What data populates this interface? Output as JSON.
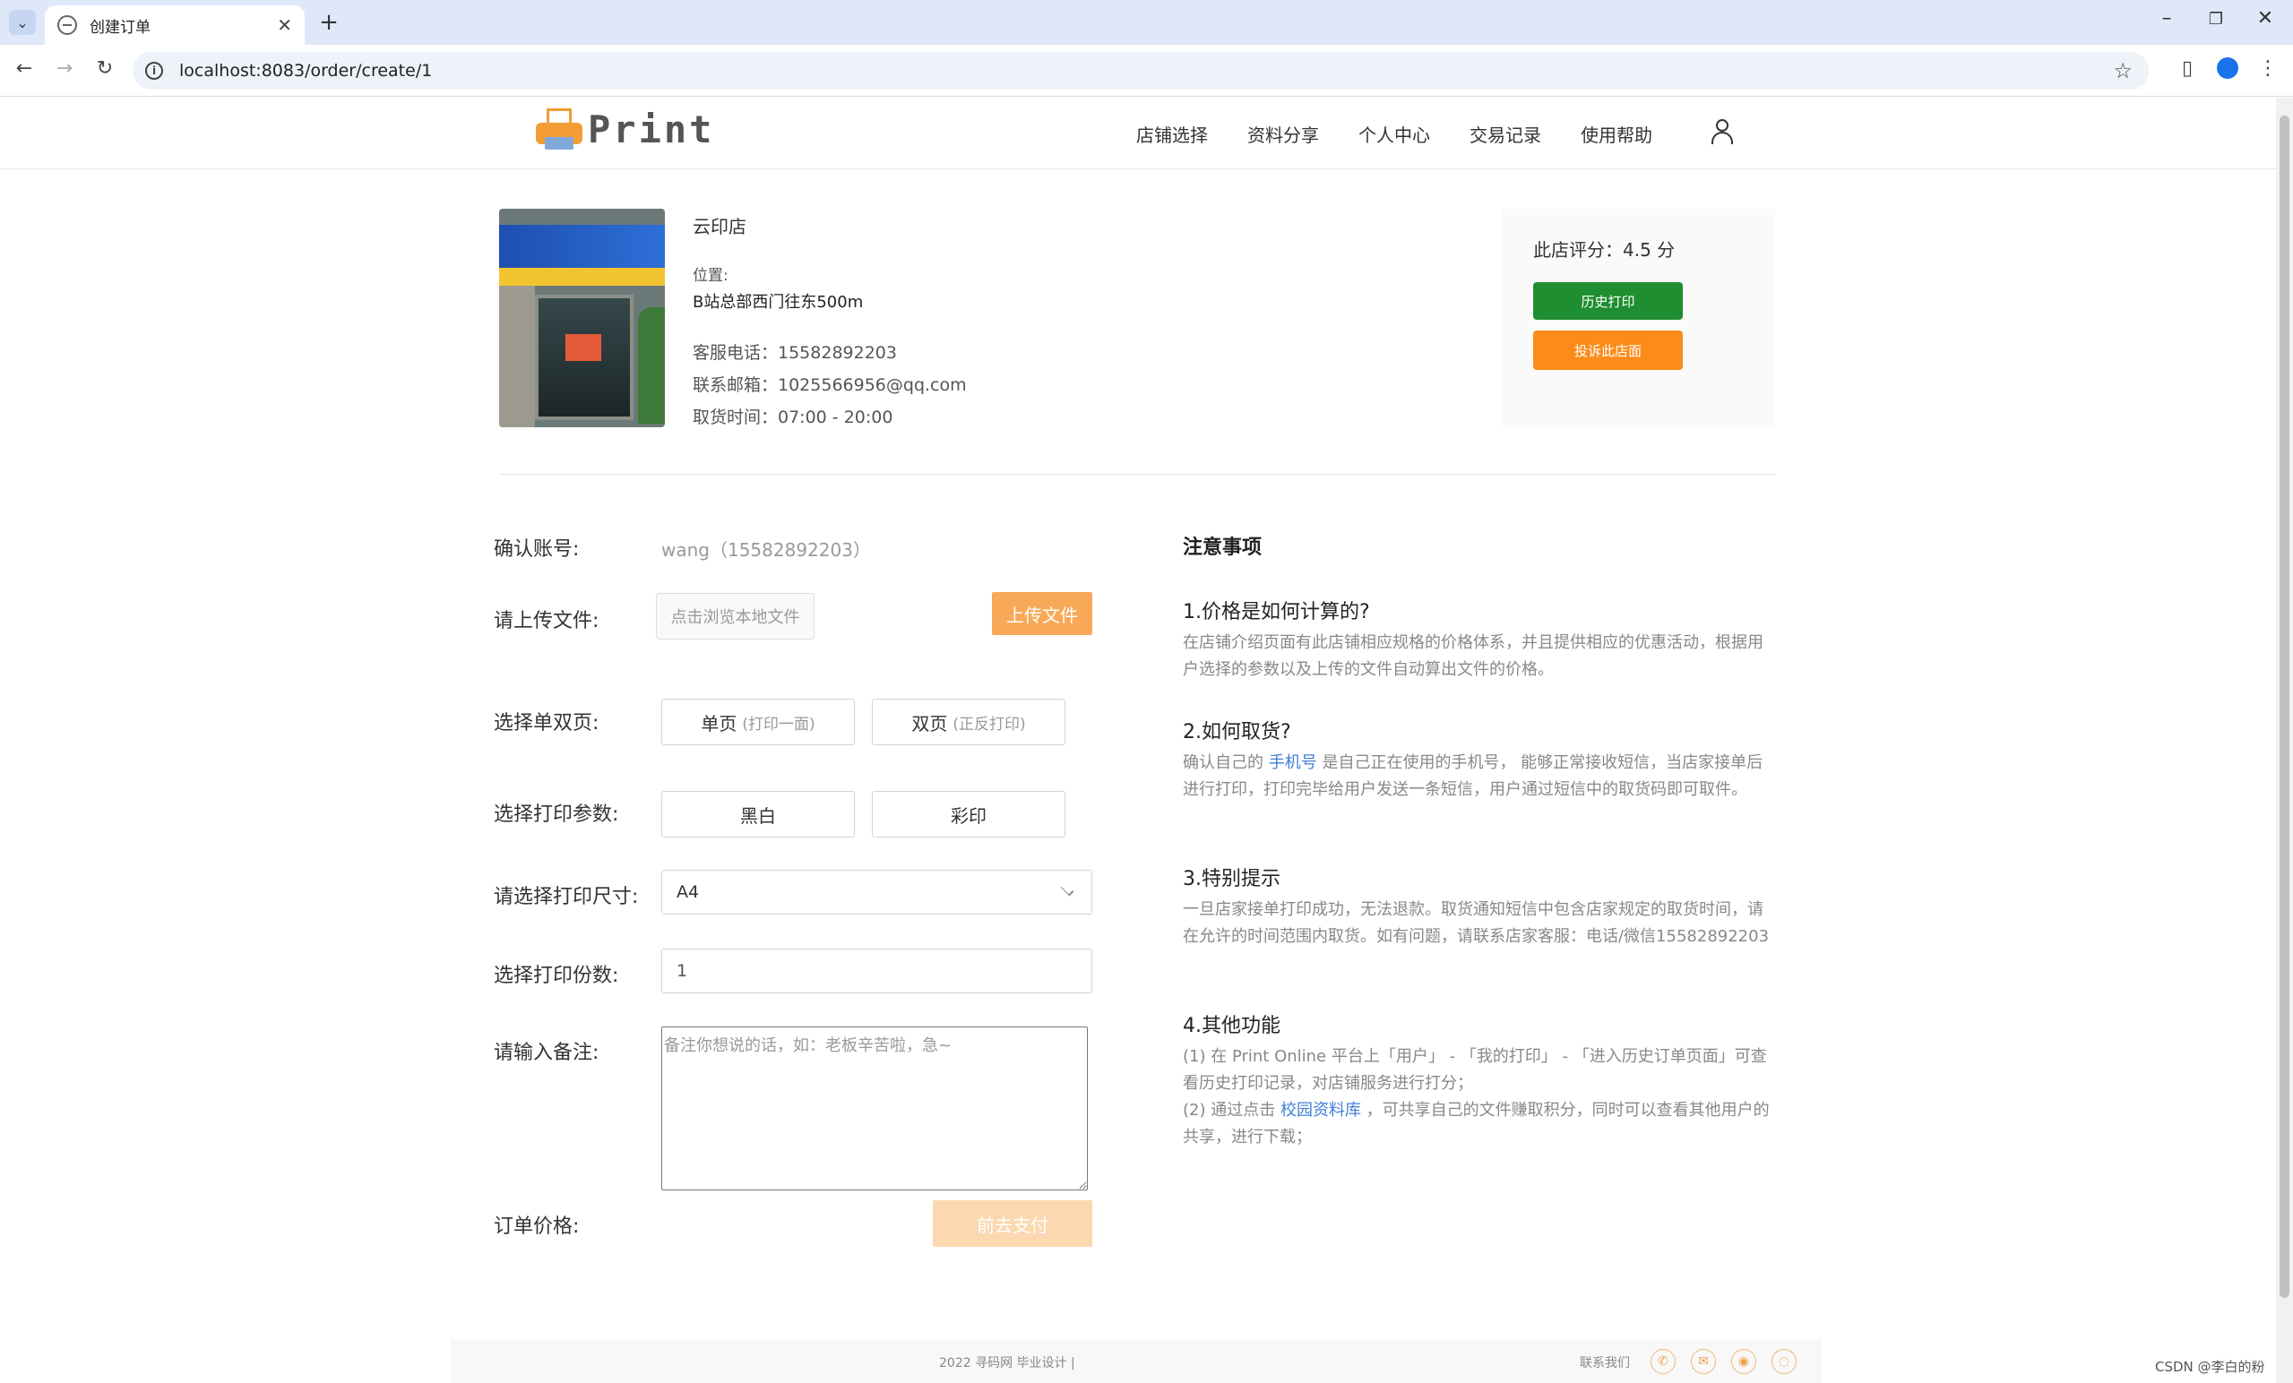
{
  "browser": {
    "tab_title": "创建订单",
    "url": "localhost:8083/order/create/1"
  },
  "site": {
    "logo_text": "Print",
    "nav": [
      "店铺选择",
      "资料分享",
      "个人中心",
      "交易记录",
      "使用帮助"
    ]
  },
  "shop": {
    "name": "云印店",
    "location_label": "位置:",
    "location": "B站总部西门往东500m",
    "phone": "客服电话：15582892203",
    "email": "联系邮箱：1025566956@qq.com",
    "pickup": "取货时间：07:00 - 20:00",
    "rating": "此店评分：4.5 分",
    "history_button": "历史打印",
    "complain_button": "投诉此店面"
  },
  "form": {
    "account_label": "确认账号:",
    "account_value": "wang（15582892203）",
    "upload_label": "请上传文件:",
    "file_placeholder": "点击浏览本地文件",
    "upload_button": "上传文件",
    "sides_label": "选择单双页:",
    "single_label": "单页",
    "single_sub": "(打印一面)",
    "double_label": "双页",
    "double_sub": "(正反打印)",
    "color_label": "选择打印参数:",
    "bw_label": "黑白",
    "color_opt_label": "彩印",
    "size_label": "请选择打印尺寸:",
    "size_value": "A4",
    "copies_label": "选择打印份数:",
    "copies_value": "1",
    "note_label": "请输入备注:",
    "note_placeholder": "备注你想说的话，如：老板辛苦啦，急~",
    "price_label": "订单价格:",
    "pay_button": "前去支付"
  },
  "notes": {
    "title": "注意事项",
    "h1": "1.价格是如何计算的?",
    "p1": "在店铺介绍页面有此店铺相应规格的价格体系，并且提供相应的优惠活动，根据用户选择的参数以及上传的文件自动算出文件的价格。",
    "h2": "2.如何取货?",
    "p2_a": "确认自己的 ",
    "p2_link": "手机号",
    "p2_b": " 是自己正在使用的手机号， 能够正常接收短信，当店家接单后进行打印，打印完毕给用户发送一条短信，用户通过短信中的取货码即可取件。",
    "h3": "3.特别提示",
    "p3": "一旦店家接单打印成功，无法退款。取货通知短信中包含店家规定的取货时间，请在允许的时间范围内取货。如有问题，请联系店家客服：电话/微信15582892203",
    "h4": "4.其他功能",
    "p4_a": "(1) 在 Print Online 平台上「用户」 - 「我的打印」 - 「进入历史订单页面」可查看历史打印记录，对店铺服务进行打分；",
    "p4_b1": "(2) 通过点击 ",
    "p4_link": "校园资料库",
    "p4_b2": " ，可共享自己的文件赚取积分，同时可以查看其他用户的共享，进行下载；"
  },
  "footer": {
    "copyright": "2022 寻码网 毕业设计 |",
    "contact": "联系我们"
  },
  "watermark": "CSDN @李白的粉",
  "colors": {
    "accent_orange": "#f8a957",
    "history_green": "#1f8e31",
    "complain_orange": "#fb8c1a",
    "link_blue": "#3f7fd6"
  }
}
